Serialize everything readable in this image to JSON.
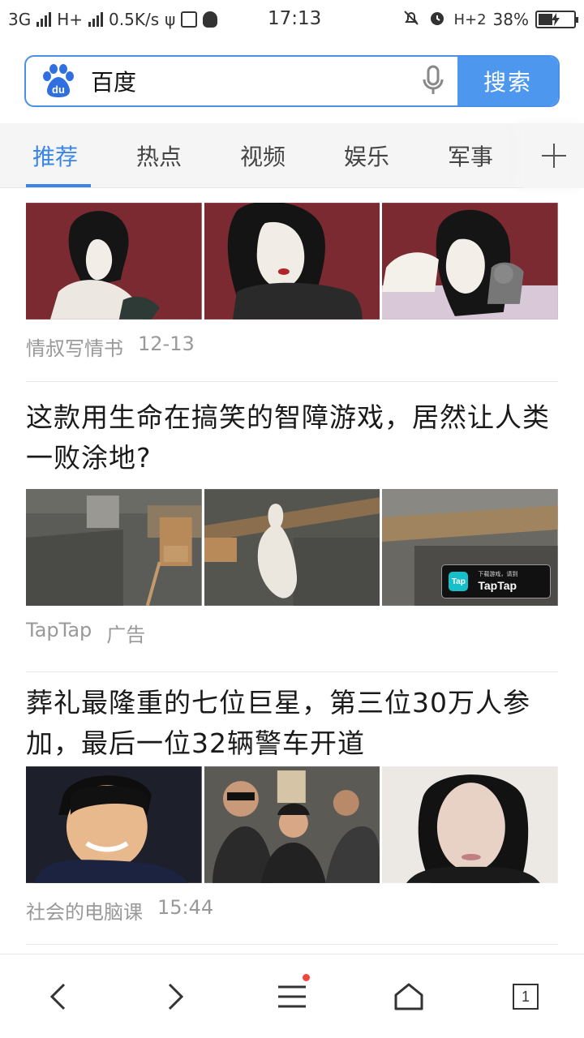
{
  "status_bar": {
    "network_1": "3G",
    "network_2": "H+",
    "speed": "0.5K/s",
    "time": "17:13",
    "network_3": "H+2",
    "battery": "38%"
  },
  "search": {
    "query": "百度",
    "button_label": "搜索",
    "logo_text": "du"
  },
  "tabs": [
    {
      "label": "推荐",
      "active": true
    },
    {
      "label": "热点",
      "active": false
    },
    {
      "label": "视频",
      "active": false
    },
    {
      "label": "娱乐",
      "active": false
    },
    {
      "label": "军事",
      "active": false
    }
  ],
  "feed": {
    "items": [
      {
        "title": "",
        "source": "情叔写情书",
        "time": "12-13"
      },
      {
        "title": "这款用生命在搞笑的智障游戏，居然让人类一败涂地?",
        "source": "TapTap",
        "time": "广告",
        "ad_badge_small": "下载游戏，请到",
        "ad_badge_brand": "TapTap",
        "ad_badge_icon": "Tap"
      },
      {
        "title": "葬礼最隆重的七位巨星，第三位30万人参加，最后一位32辆警车开道",
        "source": "社会的电脑课",
        "time": "15:44"
      }
    ]
  },
  "bottom_nav": {
    "tab_count": "1"
  },
  "colors": {
    "accent": "#3a86e8",
    "search_button": "#4e97ef",
    "notification_dot": "#f2453d"
  }
}
